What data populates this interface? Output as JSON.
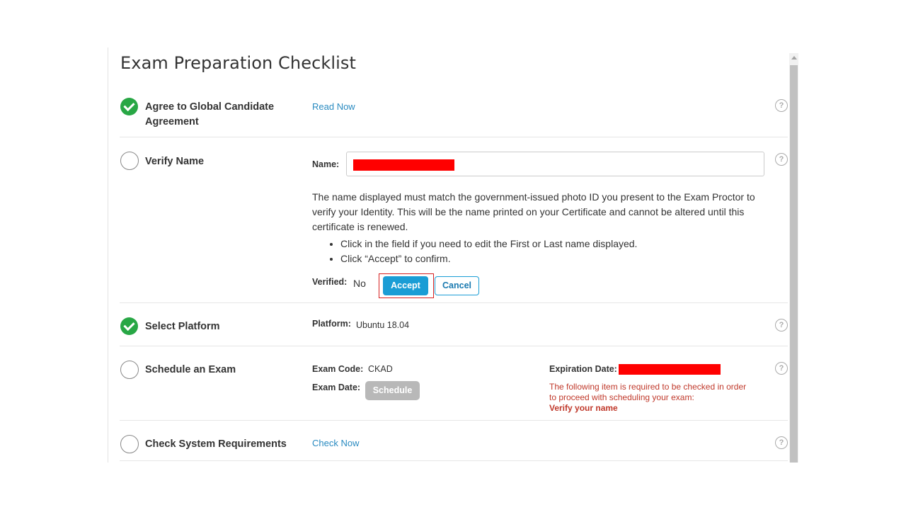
{
  "title": "Exam Preparation Checklist",
  "help_glyph": "?",
  "steps": {
    "agreement": {
      "label_line1": "Agree to Global Candidate",
      "label_line2": "Agreement",
      "status": "done",
      "link": "Read Now"
    },
    "verify_name": {
      "label": "Verify Name",
      "status": "todo",
      "name_label": "Name:",
      "name_value": "",
      "description": "The name displayed must match the government-issued photo ID you present to the Exam Proctor to verify your Identity. This will be the name printed on your Certificate and cannot be altered until this certificate is renewed.",
      "bullets": [
        "Click in the field if you need to edit the First or Last name displayed.",
        "Click “Accept” to confirm."
      ],
      "verified_label": "Verified:",
      "verified_value": "No",
      "accept_label": "Accept",
      "cancel_label": "Cancel"
    },
    "platform": {
      "label": "Select Platform",
      "status": "done",
      "platform_label": "Platform:",
      "platform_value": "Ubuntu 18.04"
    },
    "schedule": {
      "label": "Schedule an Exam",
      "status": "todo",
      "exam_code_label": "Exam Code:",
      "exam_code_value": "CKAD",
      "exam_date_label": "Exam Date:",
      "schedule_button": "Schedule",
      "expiration_label": "Expiration Date:",
      "warning_text": "The following item is required to be checked in order to proceed with scheduling your exam:",
      "warning_item": "Verify your name"
    },
    "system": {
      "label": "Check System Requirements",
      "status": "todo",
      "link": "Check Now"
    }
  },
  "colors": {
    "done": "#28a745",
    "link": "#2a8bc1",
    "accent": "#1a9dd5",
    "warning": "#c0392b",
    "redaction": "#ff0000"
  }
}
